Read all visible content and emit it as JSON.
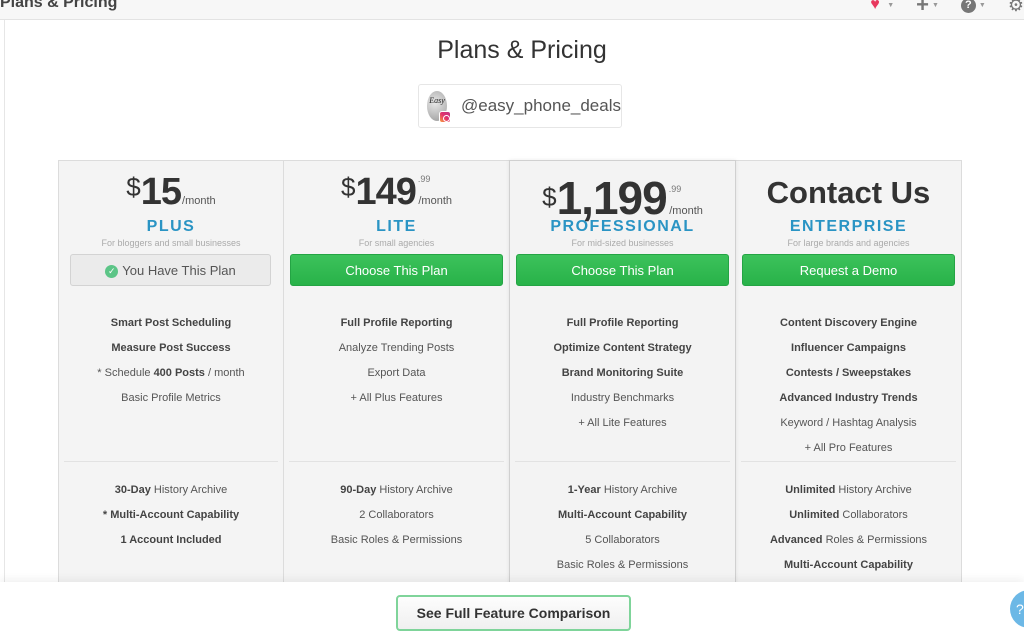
{
  "topbar": {
    "title": "Plans & Pricing",
    "icons": [
      "heart-icon",
      "plus-icon",
      "help-icon",
      "gear-icon"
    ]
  },
  "page": {
    "title": "Plans & Pricing",
    "account_handle": "@easy_phone_deals",
    "avatar_text": "Easy"
  },
  "plans": [
    {
      "currency": "$",
      "amount": "15",
      "cents": "",
      "per": "/month",
      "name": "PLUS",
      "subtitle": "For bloggers and small businesses",
      "cta": "You Have This Plan",
      "features": [
        {
          "bold": "Smart Post Scheduling",
          "rest": ""
        },
        {
          "bold": "Measure Post Success",
          "rest": ""
        },
        {
          "pre": "* Schedule ",
          "bold": "400 Posts",
          "rest": " / month"
        },
        {
          "bold": "",
          "rest": "Basic Profile Metrics"
        }
      ],
      "features2": [
        {
          "bold": "30-Day",
          "rest": " History Archive"
        },
        {
          "bold": "* Multi-Account Capability",
          "rest": ""
        },
        {
          "bold": "1 Account Included",
          "rest": ""
        }
      ]
    },
    {
      "currency": "$",
      "amount": "149",
      "cents": ".99",
      "per": "/month",
      "name": "LITE",
      "subtitle": "For small agencies",
      "cta": "Choose This Plan",
      "features": [
        {
          "bold": "Full Profile Reporting",
          "rest": ""
        },
        {
          "bold": "",
          "rest": "Analyze Trending Posts"
        },
        {
          "bold": "",
          "rest": "Export Data"
        },
        {
          "bold": "",
          "rest": "+ All Plus Features"
        }
      ],
      "features2": [
        {
          "bold": "90-Day",
          "rest": " History Archive"
        },
        {
          "bold": "",
          "rest": "2 Collaborators"
        },
        {
          "bold": "",
          "rest": "Basic Roles & Permissions"
        }
      ]
    },
    {
      "currency": "$",
      "amount": "1,199",
      "cents": ".99",
      "per": "/month",
      "name": "PROFESSIONAL",
      "subtitle": "For mid-sized businesses",
      "cta": "Choose This Plan",
      "features": [
        {
          "bold": "Full Profile Reporting",
          "rest": ""
        },
        {
          "bold": "Optimize Content Strategy",
          "rest": ""
        },
        {
          "bold": "Brand Monitoring Suite",
          "rest": ""
        },
        {
          "bold": "",
          "rest": "Industry Benchmarks"
        },
        {
          "bold": "",
          "rest": "+ All Lite Features"
        }
      ],
      "features2": [
        {
          "bold": "1-Year",
          "rest": " History Archive"
        },
        {
          "bold": "Multi-Account Capability",
          "rest": ""
        },
        {
          "bold": "",
          "rest": "5 Collaborators"
        },
        {
          "bold": "",
          "rest": "Basic Roles & Permissions"
        }
      ]
    },
    {
      "contact": "Contact Us",
      "name": "ENTERPRISE",
      "subtitle": "For large brands and agencies",
      "cta": "Request a Demo",
      "features": [
        {
          "bold": "Content Discovery Engine",
          "rest": ""
        },
        {
          "bold": "Influencer Campaigns",
          "rest": ""
        },
        {
          "bold": "Contests / Sweepstakes",
          "rest": ""
        },
        {
          "bold": "Advanced Industry Trends",
          "rest": ""
        },
        {
          "bold": "",
          "rest": "Keyword / Hashtag Analysis"
        },
        {
          "bold": "",
          "rest": "+ All Pro Features"
        }
      ],
      "features2": [
        {
          "bold": "Unlimited",
          "rest": " History Archive"
        },
        {
          "bold": "Unlimited",
          "rest": " Collaborators"
        },
        {
          "bold": "Advanced",
          "rest": " Roles & Permissions"
        },
        {
          "bold": "Multi-Account Capability",
          "rest": ""
        }
      ]
    }
  ],
  "footer": {
    "compare_label": "See Full Feature Comparison",
    "help_glyph": "?"
  }
}
